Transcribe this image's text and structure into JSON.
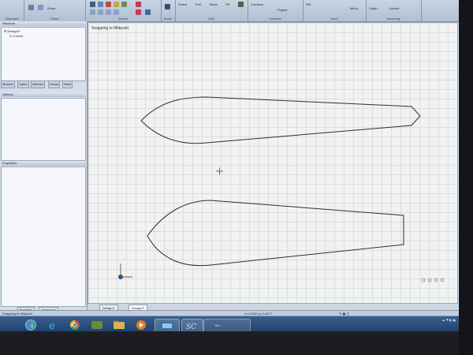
{
  "ribbon": {
    "groups": [
      {
        "label": "Clipboard"
      },
      {
        "label": "Orient"
      },
      {
        "label": "Sketch"
      },
      {
        "label": "Mode"
      },
      {
        "label": "Edit"
      },
      {
        "label": "Intersect"
      },
      {
        "label": "Insert"
      },
      {
        "label": "Assembly"
      }
    ],
    "buttons": {
      "zoom": "Zoom",
      "select": "Select",
      "pull": "Pull",
      "move": "Move",
      "fill": "Fill",
      "combine": "Combine",
      "project": "Project",
      "file": "File",
      "mirror": "Mirror",
      "origin": "Origin",
      "anchor": "Anchor"
    }
  },
  "structure_panel": {
    "title": "Structure",
    "tree": [
      {
        "label": "Design2*"
      },
      {
        "label": "Curves"
      }
    ],
    "tabs": [
      "Structure",
      "Layers",
      "Selection",
      "Groups",
      "Views"
    ]
  },
  "options_panel": {
    "title": "Options"
  },
  "properties_panel": {
    "title": "Properties"
  },
  "bottom_tabs": [
    "Properties",
    "Appearance"
  ],
  "canvas": {
    "hint": "Snapping to Midpoint"
  },
  "doc_tabs": [
    "Design1*",
    "Design2*"
  ],
  "status": {
    "left": "Snapping to Midpoint",
    "coords": "x=0.1000  y=-0.4277"
  },
  "taskbar": {
    "active_window": "Ne..."
  }
}
